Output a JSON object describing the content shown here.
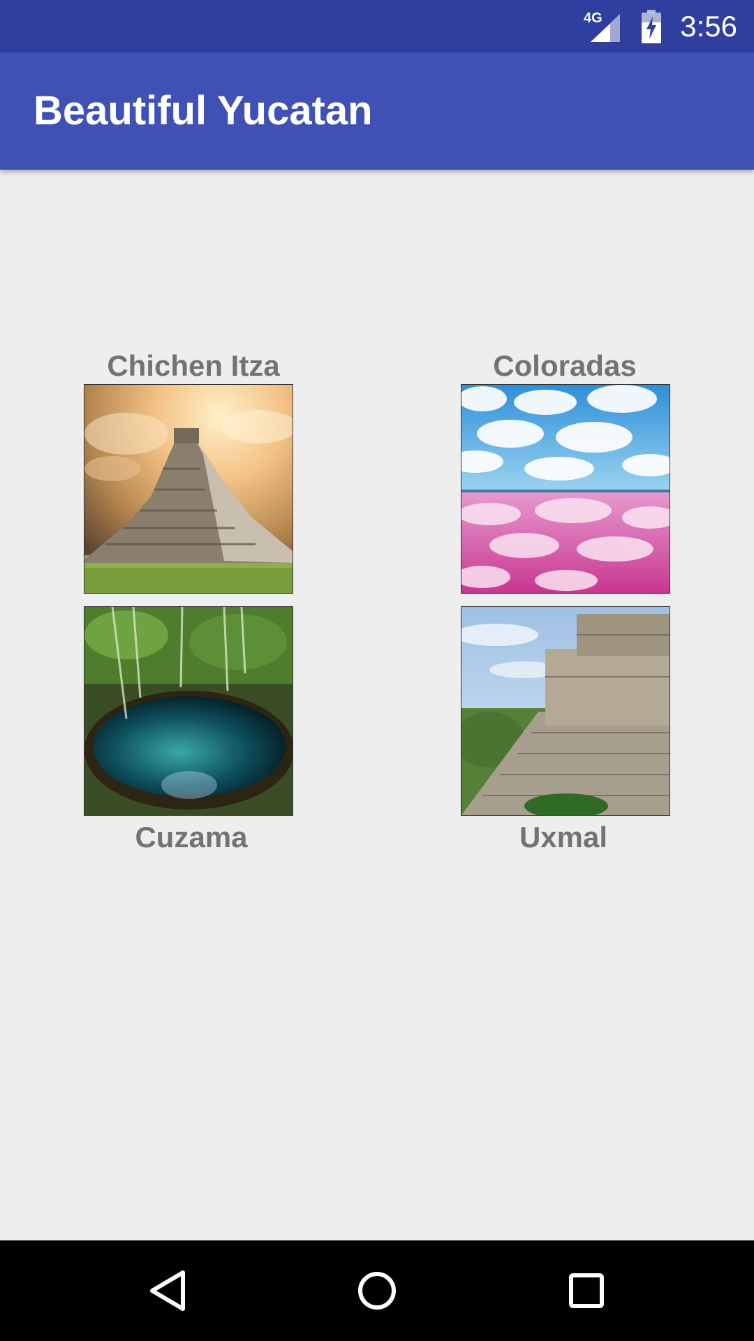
{
  "status_bar": {
    "network": "4G",
    "time": "3:56",
    "icons": [
      "network-4g-icon",
      "signal-icon",
      "battery-charging-icon"
    ]
  },
  "app_bar": {
    "title": "Beautiful Yucatan"
  },
  "places": [
    {
      "label": "Chichen Itza",
      "image": "pyramid-photo"
    },
    {
      "label": "Coloradas",
      "image": "pink-lake-photo"
    },
    {
      "label": "Cuzama",
      "image": "cenote-photo"
    },
    {
      "label": "Uxmal",
      "image": "maya-temple-photo"
    }
  ],
  "nav_bar": {
    "icons": [
      "back-icon",
      "home-icon",
      "recents-icon"
    ]
  },
  "colors": {
    "status_bar": "#303f9f",
    "app_bar": "#3f51b5",
    "background": "#eeeeee",
    "label": "#737373"
  }
}
